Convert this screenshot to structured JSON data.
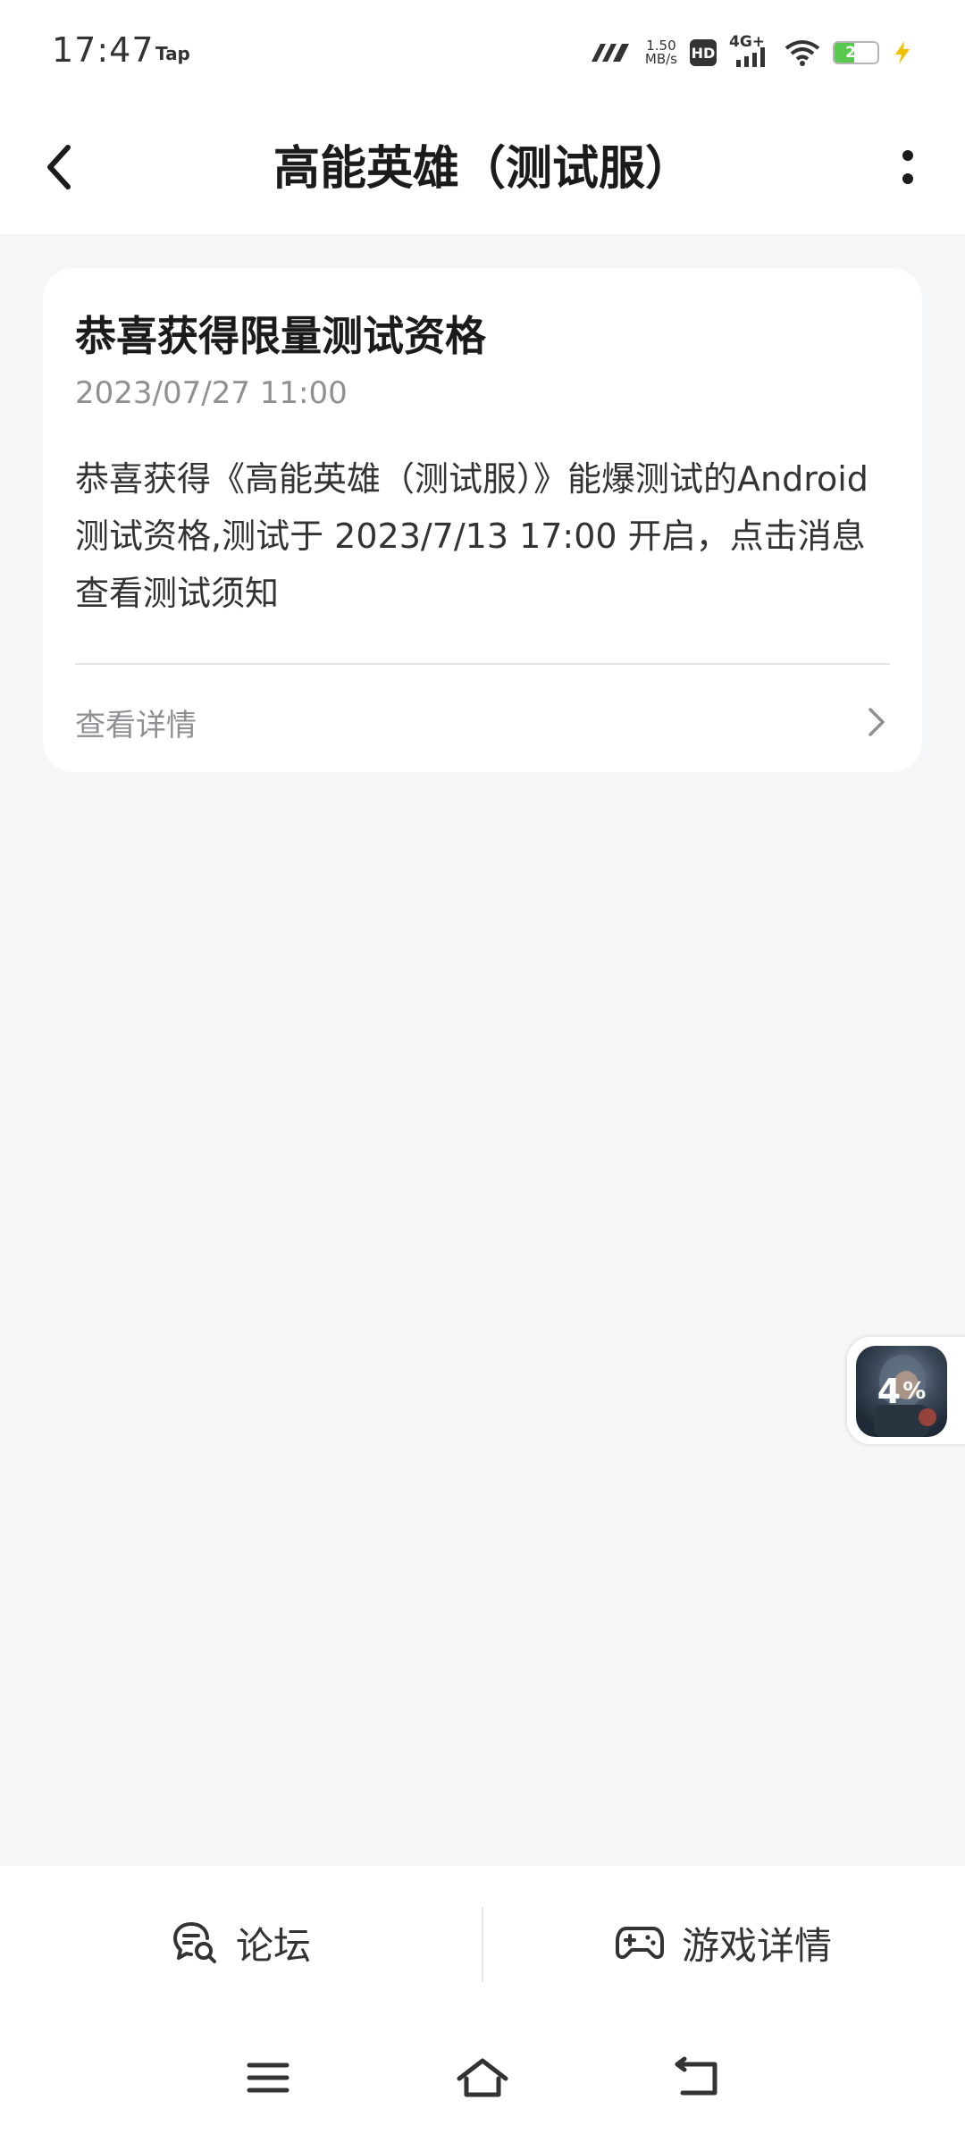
{
  "status_bar": {
    "time": "17:47",
    "app_tag": "Tap",
    "net_speed_value": "1.50",
    "net_speed_unit": "MB/s",
    "hd_badge": "HD",
    "network": "4G+",
    "battery_level": "27",
    "battery_color": "#58C84E"
  },
  "header": {
    "title": "高能英雄（测试服）",
    "back_icon": "chevron-left-icon",
    "more_icon": "more-vertical-icon"
  },
  "card": {
    "title": "恭喜获得限量测试资格",
    "date": "2023/07/27 11:00",
    "body": "恭喜获得《高能英雄（测试服）》能爆测试的Android测试资格,测试于 2023/7/13 17:00 开启，点击消息查看测试须知",
    "detail_label": "查看详情"
  },
  "float_widget": {
    "progress_number": "4",
    "progress_unit": "%"
  },
  "bottom_bar": {
    "forum_label": "论坛",
    "game_detail_label": "游戏详情"
  },
  "nav_bar": {
    "menu_icon": "menu-icon",
    "home_icon": "home-icon",
    "back_icon": "back-icon"
  }
}
